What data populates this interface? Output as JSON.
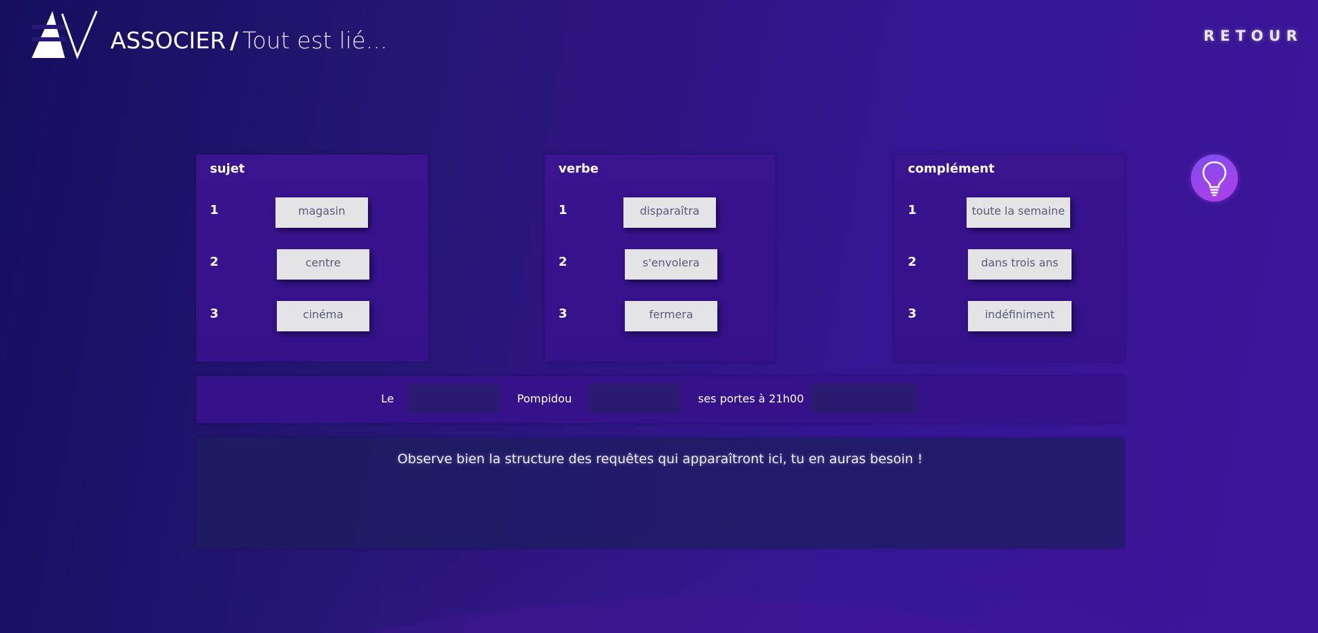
{
  "header": {
    "title_main": "ASSOCIER",
    "title_separator": "/",
    "title_sub": "Tout est lié...",
    "back_label": "RETOUR"
  },
  "columns": [
    {
      "title": "sujet",
      "rows": [
        {
          "num": "1",
          "word": "magasin"
        },
        {
          "num": "2",
          "word": "centre"
        },
        {
          "num": "3",
          "word": "cinéma"
        }
      ]
    },
    {
      "title": "verbe",
      "rows": [
        {
          "num": "1",
          "word": "disparaîtra"
        },
        {
          "num": "2",
          "word": "s'envolera"
        },
        {
          "num": "3",
          "word": "fermera"
        }
      ]
    },
    {
      "title": "complément",
      "rows": [
        {
          "num": "1",
          "word": "toute la semaine"
        },
        {
          "num": "2",
          "word": "dans trois ans"
        },
        {
          "num": "3",
          "word": "indéfiniment"
        }
      ]
    }
  ],
  "sentence": {
    "part1": "Le",
    "part2": "Pompidou",
    "part3": "ses portes à 21h00"
  },
  "result": {
    "message": "Observe bien la structure des requêtes qui apparaîtront ici, tu en auras besoin !"
  },
  "icons": {
    "logo": "av-logo-icon",
    "hint": "lightbulb-icon"
  },
  "colors": {
    "chip_bg": "#e4e4e6",
    "chip_text": "#5a5a7a",
    "panel_bg": "#35128a",
    "hint_gradient_start": "#7e4ff0",
    "hint_gradient_end": "#b23ce6"
  }
}
